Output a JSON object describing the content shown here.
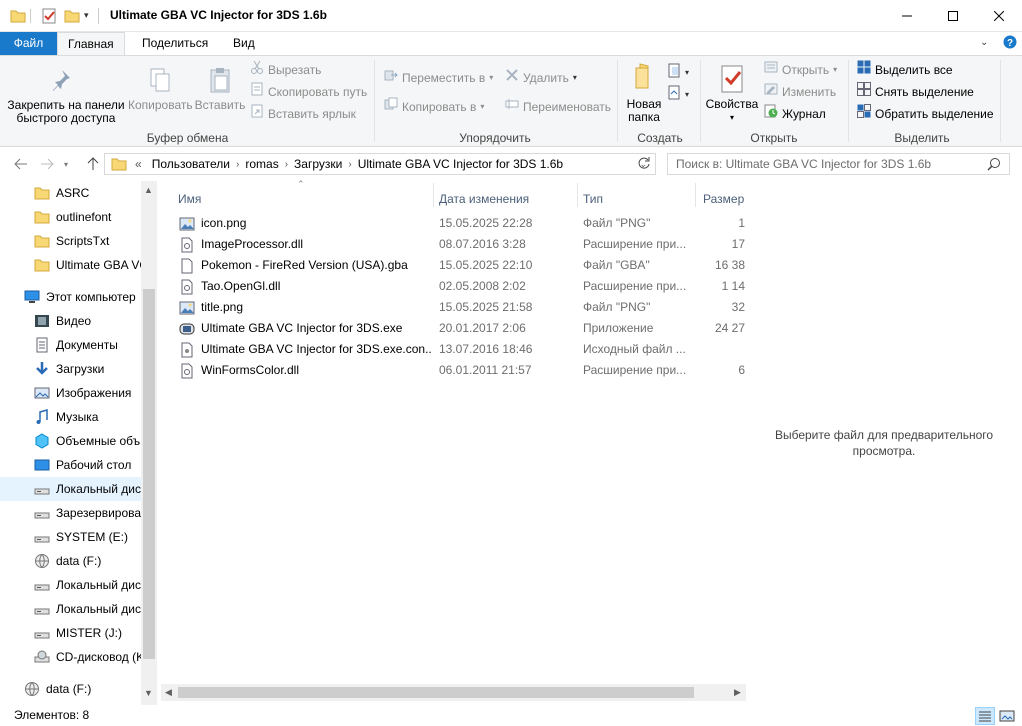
{
  "window": {
    "title": "Ultimate GBA VC Injector for 3DS 1.6b",
    "minimize": "—",
    "maximize": "☐",
    "close": "✕"
  },
  "ribbon_tabs": {
    "file": "Файл",
    "home": "Главная",
    "share": "Поделиться",
    "view": "Вид"
  },
  "ribbon": {
    "clipboard": {
      "pin": "Закрепить на панели быстрого доступа",
      "pin_line1": "Закрепить на панели",
      "pin_line2": "быстрого доступа",
      "copy": "Копировать",
      "paste": "Вставить",
      "cut": "Вырезать",
      "copy_path": "Скопировать путь",
      "paste_shortcut": "Вставить ярлык",
      "label": "Буфер обмена"
    },
    "organize": {
      "move_to": "Переместить в",
      "copy_to": "Копировать в",
      "delete": "Удалить",
      "rename": "Переименовать",
      "label": "Упорядочить"
    },
    "new": {
      "new_folder_line1": "Новая",
      "new_folder_line2": "папка",
      "label": "Создать"
    },
    "open": {
      "properties": "Свойства",
      "open": "Открыть",
      "edit": "Изменить",
      "history": "Журнал",
      "label": "Открыть"
    },
    "select": {
      "select_all": "Выделить все",
      "select_none": "Снять выделение",
      "invert": "Обратить выделение",
      "label": "Выделить"
    }
  },
  "address": {
    "prefix": "«",
    "crumbs": [
      "Пользователи",
      "romas",
      "Загрузки",
      "Ultimate GBA VC Injector for 3DS 1.6b"
    ],
    "search_placeholder": "Поиск в: Ultimate GBA VC Injector for 3DS 1.6b"
  },
  "nav": [
    {
      "label": "ASRC",
      "icon": "folder-icon"
    },
    {
      "label": "outlinefont",
      "icon": "folder-icon"
    },
    {
      "label": "ScriptsTxt",
      "icon": "folder-icon"
    },
    {
      "label": "Ultimate GBA VC",
      "icon": "folder-icon"
    },
    {
      "label": "Этот компьютер",
      "icon": "computer-icon"
    },
    {
      "label": "Видео",
      "icon": "video-icon"
    },
    {
      "label": "Документы",
      "icon": "documents-icon"
    },
    {
      "label": "Загрузки",
      "icon": "downloads-icon"
    },
    {
      "label": "Изображения",
      "icon": "pictures-icon"
    },
    {
      "label": "Музыка",
      "icon": "music-icon"
    },
    {
      "label": "Объемные объ",
      "icon": "3d-objects-icon"
    },
    {
      "label": "Рабочий стол",
      "icon": "desktop-icon"
    },
    {
      "label": "Локальный дис",
      "icon": "drive-icon"
    },
    {
      "label": "Зарезервирован",
      "icon": "drive-icon"
    },
    {
      "label": "SYSTEM (E:)",
      "icon": "drive-icon"
    },
    {
      "label": "data (F:)",
      "icon": "network-drive-icon"
    },
    {
      "label": "Локальный дис",
      "icon": "drive-icon"
    },
    {
      "label": "Локальный дис",
      "icon": "drive-icon"
    },
    {
      "label": "MISTER (J:)",
      "icon": "drive-icon"
    },
    {
      "label": "CD-дисковод (K",
      "icon": "cd-drive-icon"
    },
    {
      "label": "data (F:)",
      "icon": "network-drive-icon"
    }
  ],
  "columns": {
    "name": "Имя",
    "date": "Дата изменения",
    "type": "Тип",
    "size": "Размер"
  },
  "files": [
    {
      "name": "icon.png",
      "date": "15.05.2025 22:28",
      "type": "Файл \"PNG\"",
      "size": "1",
      "icon": "image-file-icon"
    },
    {
      "name": "ImageProcessor.dll",
      "date": "08.07.2016 3:28",
      "type": "Расширение при...",
      "size": "17",
      "icon": "dll-file-icon"
    },
    {
      "name": "Pokemon - FireRed Version (USA).gba",
      "date": "15.05.2025 22:10",
      "type": "Файл \"GBA\"",
      "size": "16 38",
      "icon": "generic-file-icon"
    },
    {
      "name": "Tao.OpenGl.dll",
      "date": "02.05.2008 2:02",
      "type": "Расширение при...",
      "size": "1 14",
      "icon": "dll-file-icon"
    },
    {
      "name": "title.png",
      "date": "15.05.2025 21:58",
      "type": "Файл \"PNG\"",
      "size": "32",
      "icon": "image-file-icon"
    },
    {
      "name": "Ultimate GBA VC Injector for 3DS.exe",
      "date": "20.01.2017 2:06",
      "type": "Приложение",
      "size": "24 27",
      "icon": "exe-file-icon"
    },
    {
      "name": "Ultimate GBA VC Injector for 3DS.exe.con...",
      "date": "13.07.2016 18:46",
      "type": "Исходный файл ...",
      "size": "",
      "icon": "config-file-icon"
    },
    {
      "name": "WinFormsColor.dll",
      "date": "06.01.2011 21:57",
      "type": "Расширение при...",
      "size": "6",
      "icon": "dll-file-icon"
    }
  ],
  "preview": {
    "message": "Выберите файл для предварительного просмотра."
  },
  "status": {
    "count": "Элементов: 8"
  },
  "colors": {
    "accent": "#1979ca",
    "selection": "#e5f3ff",
    "folder": "#f8d775"
  }
}
